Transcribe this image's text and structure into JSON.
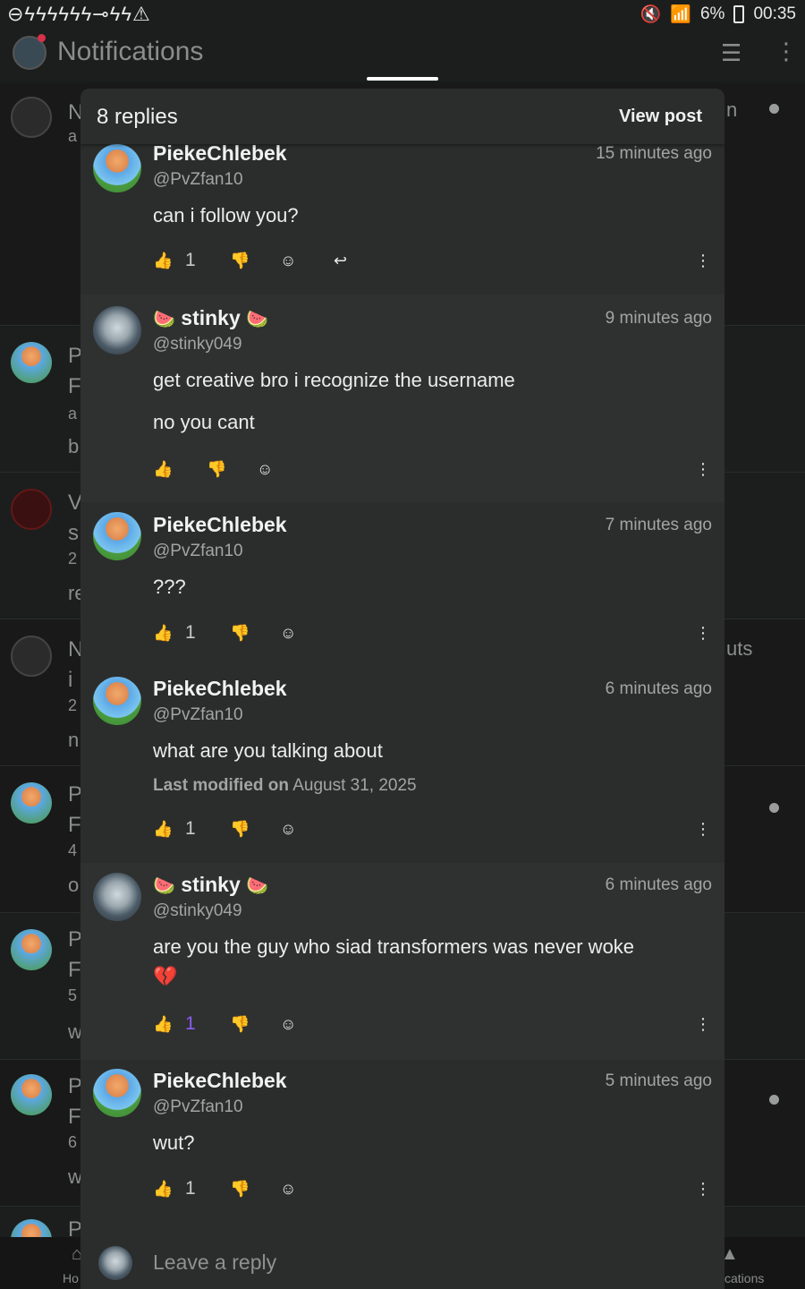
{
  "status": {
    "left_icons": "⊖ϟϟϟϟϟϟ⊸ϟϟ⚠",
    "battery": "6%",
    "time": "00:35"
  },
  "appbar": {
    "title": "Notifications"
  },
  "background": {
    "rows": [
      {
        "l1": "N",
        "l2": "a"
      },
      {
        "l1": "P",
        "l2": "F",
        "l3": "a",
        "l4": "b"
      },
      {
        "l1": "V",
        "l2": "s",
        "l3": "2",
        "l4": "re"
      },
      {
        "l1": "N",
        "l2": "i",
        "l3": "2",
        "l4": "n"
      },
      {
        "l1": "P",
        "l2": "F",
        "l3": "4",
        "l4": "o"
      },
      {
        "l1": "P",
        "l2": "F",
        "l3": "5",
        "l4": "w"
      },
      {
        "l1": "P",
        "l2": "F",
        "l3": "6",
        "l4": "w"
      },
      {
        "l1": "P"
      }
    ],
    "right_fragment_1": "n",
    "right_fragment_2": "uts"
  },
  "bottomnav": {
    "left_label": "Ho",
    "right_label": "cations"
  },
  "sheet": {
    "reply_count": "8 replies",
    "view_post": "View post"
  },
  "comments": [
    {
      "name": "PiekeChlebek",
      "handle": "@PvZfan10",
      "time": "15 minutes ago",
      "lines": [
        "can i follow you?"
      ],
      "likes": "1",
      "has_reply": true
    },
    {
      "name": "stinky",
      "handle": "@stinky049",
      "time": "9 minutes ago",
      "lines": [
        "get creative bro i recognize the username",
        "no you cant"
      ],
      "likes": ""
    },
    {
      "name": "PiekeChlebek",
      "handle": "@PvZfan10",
      "time": "7 minutes ago",
      "lines": [
        "???"
      ],
      "likes": "1"
    },
    {
      "name": "PiekeChlebek",
      "handle": "@PvZfan10",
      "time": "6 minutes ago",
      "lines": [
        "what are you talking about"
      ],
      "meta_label": "Last modified on",
      "meta_date": "August 31, 2025",
      "likes": "1"
    },
    {
      "name": "stinky",
      "handle": "@stinky049",
      "time": "6 minutes ago",
      "lines": [
        "are you the guy who siad transformers was never woke"
      ],
      "emoji": "💔",
      "likes": "1",
      "liked": true
    },
    {
      "name": "PiekeChlebek",
      "handle": "@PvZfan10",
      "time": "5 minutes ago",
      "lines": [
        "wut?"
      ],
      "likes": "1"
    }
  ],
  "reply_input": {
    "placeholder": "Leave a reply"
  },
  "colors": {
    "background": "#1c1e1d",
    "sheet": "#2b2d2c",
    "liked_accent": "#8b5cf6"
  }
}
